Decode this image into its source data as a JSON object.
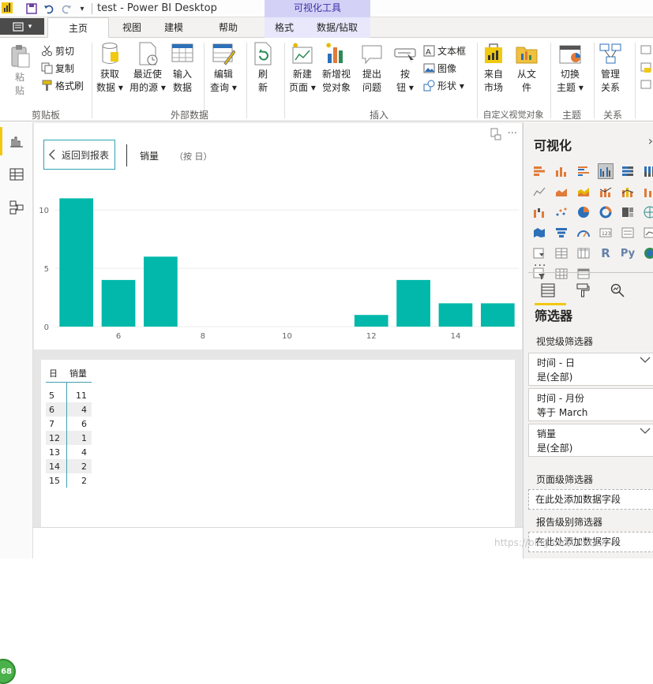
{
  "titlebar": {
    "title": "test - Power BI Desktop",
    "context_tool": "可视化工具",
    "icons": [
      "powerbi-logo",
      "save-icon",
      "undo-icon",
      "redo-icon",
      "customize-qat-icon"
    ]
  },
  "tabs": [
    {
      "label": "主页",
      "active": true
    },
    {
      "label": "视图"
    },
    {
      "label": "建模"
    },
    {
      "label": "帮助"
    },
    {
      "label": "格式"
    },
    {
      "label": "数据/钻取"
    }
  ],
  "ribbon": {
    "paste": "粘\n贴",
    "cut": "剪切",
    "copy": "复制",
    "format_painter": "格式刷",
    "get_data": "获取\n数据 ▾",
    "recent_sources": "最近使\n用的源 ▾",
    "enter_data": "输入\n数据",
    "edit_queries": "编辑\n查询 ▾",
    "refresh": "刷\n新",
    "new_page": "新建\n页面 ▾",
    "new_visual": "新增视\n觉对象",
    "ask_question": "提出\n问题",
    "buttons": "按\n钮 ▾",
    "textbox": "文本框",
    "image": "图像",
    "shapes": "形状 ▾",
    "from_marketplace": "来自\n市场",
    "from_file": "从文\n件",
    "switch_theme": "切换\n主题 ▾",
    "manage_relationships": "管理\n关系",
    "groups": {
      "clipboard": "剪贴板",
      "external_data": "外部数据",
      "insert": "插入",
      "custom_visuals": "自定义视觉对象",
      "themes": "主题",
      "relationships": "关系"
    }
  },
  "focus_header": {
    "back_label": "返回到报表",
    "visual_title": "销量",
    "visual_subtitle": "（按 日）"
  },
  "chart_data": {
    "type": "bar",
    "categories": [
      5,
      6,
      7,
      12,
      13,
      14,
      15
    ],
    "values": [
      11,
      4,
      6,
      1,
      4,
      2,
      2
    ],
    "x_ticks": [
      6,
      8,
      10,
      12,
      14
    ],
    "y_ticks": [
      0,
      5,
      10
    ],
    "ylim": [
      0,
      11.5
    ],
    "xlim": [
      4.5,
      15.5
    ],
    "bar_color": "#01b8aa",
    "grid": true
  },
  "table": {
    "headers": [
      "日",
      "销量"
    ],
    "rows": [
      {
        "day": "5",
        "value": "11"
      },
      {
        "day": "6",
        "value": "4"
      },
      {
        "day": "7",
        "value": "6"
      },
      {
        "day": "12",
        "value": "1"
      },
      {
        "day": "13",
        "value": "4"
      },
      {
        "day": "14",
        "value": "2"
      },
      {
        "day": "15",
        "value": "2"
      }
    ]
  },
  "visualizations": {
    "title": "可视化",
    "more": "···",
    "filters_title": "筛选器",
    "visual_level": "视觉级筛选器",
    "page_level": "页面级筛选器",
    "report_level": "报告级别筛选器",
    "drop_hint_page": "在此处添加数据字段",
    "drop_hint_report": "在此处添加数据字段",
    "filters": [
      {
        "name": "时间 - 日",
        "value": "是(全部)",
        "expandable": true
      },
      {
        "name": "时间 - 月份",
        "value": "等于 March",
        "expandable": false
      },
      {
        "name": "销量",
        "value": "是(全部)",
        "expandable": true
      }
    ]
  },
  "status": {
    "badge": "68",
    "watermark": "https://blog.csdn.net/LX"
  },
  "colors": {
    "accent": "#f2c811",
    "bar": "#01b8aa",
    "context_tab": "#d3d2f6"
  }
}
